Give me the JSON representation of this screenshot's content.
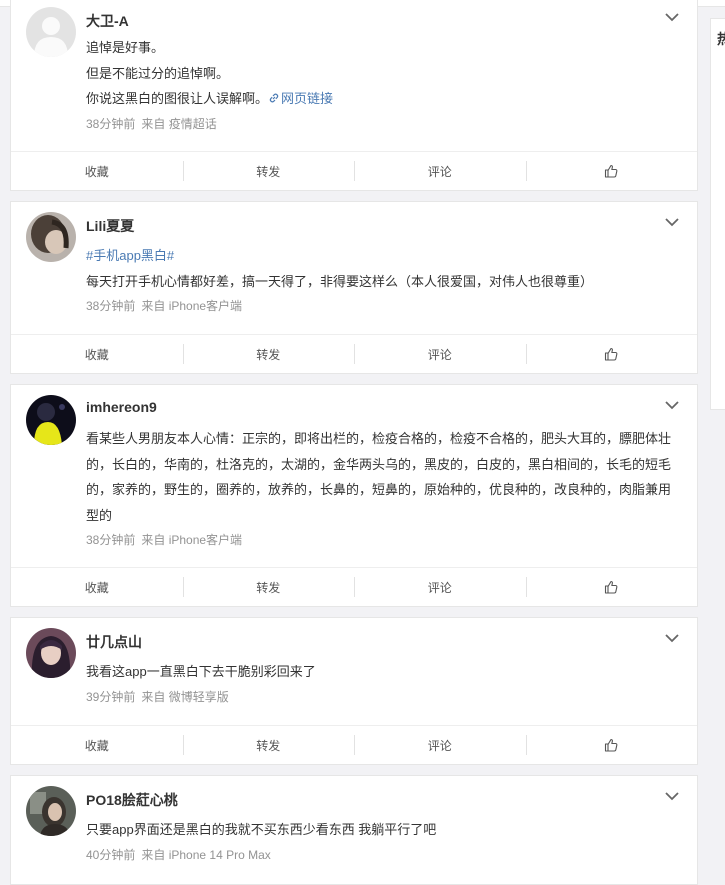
{
  "side_panel": {
    "label": "热"
  },
  "actions": {
    "favorite": "收藏",
    "repost": "转发",
    "comment": "评论"
  },
  "posts": [
    {
      "user": "大卫-A",
      "lines": [
        "追悼是好事。",
        "但是不能过分的追悼啊。",
        "你说这黑白的图很让人误解啊。"
      ],
      "link_text": "网页链接",
      "time": "38分钟前",
      "source": "来自 疫情超话"
    },
    {
      "user": "Lili夏夏",
      "hashtag": "#手机app黑白#",
      "text": "每天打开手机心情都好差，搞一天得了，非得要这样么（本人很爱国，对伟人也很尊重）",
      "time": "38分钟前",
      "source": "来自 iPhone客户端"
    },
    {
      "user": "imhereon9",
      "text": "看某些人男朋友本人心情：正宗的，即将出栏的，检疫合格的，检疫不合格的，肥头大耳的，膘肥体壮的，长白的，华南的，杜洛克的，太湖的，金华两头乌的，黑皮的，白皮的，黑白相间的，长毛的短毛的，家养的，野生的，圈养的，放养的，长鼻的，短鼻的，原始种的，优良种的，改良种的，肉脂兼用型的",
      "time": "38分钟前",
      "source": "来自 iPhone客户端"
    },
    {
      "user": "廿几点山",
      "text": "我看这app一直黑白下去干脆别彩回来了",
      "time": "39分钟前",
      "source": "来自 微博轻享版"
    },
    {
      "user": "PO18脍葒心桃",
      "text": "只要app界面还是黑白的我就不买东西少看东西 我躺平行了吧",
      "time": "40分钟前",
      "source": "来自 iPhone 14 Pro Max"
    }
  ]
}
